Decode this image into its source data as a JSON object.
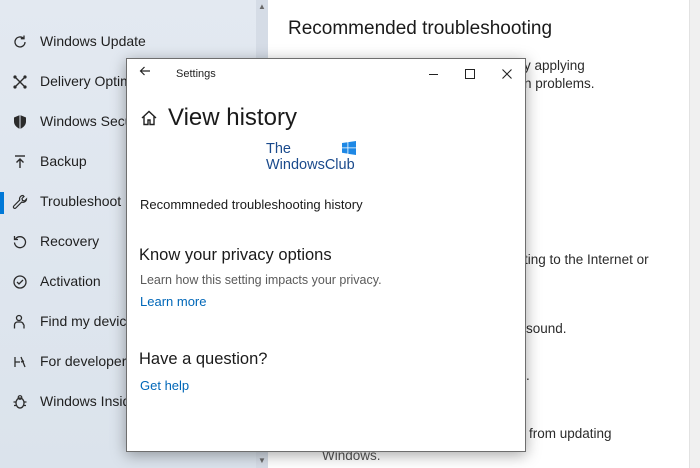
{
  "sidebar": {
    "items": [
      {
        "label": "Windows Update",
        "icon": "sync-icon"
      },
      {
        "label": "Delivery Optim",
        "icon": "delivery-icon"
      },
      {
        "label": "Windows Secu",
        "icon": "shield-icon"
      },
      {
        "label": "Backup",
        "icon": "backup-icon"
      },
      {
        "label": "Troubleshoot",
        "icon": "wrench-icon"
      },
      {
        "label": "Recovery",
        "icon": "recovery-icon"
      },
      {
        "label": "Activation",
        "icon": "activation-icon"
      },
      {
        "label": "Find my device",
        "icon": "person-location-icon"
      },
      {
        "label": "For developers",
        "icon": "developer-icon"
      },
      {
        "label": "Windows Insid",
        "icon": "insider-icon"
      }
    ],
    "selected_index": 4
  },
  "main": {
    "title": "Recommended troubleshooting",
    "fragments": [
      "y applying",
      "n problems.",
      "ting to the Internet or",
      "sound.",
      ".",
      "from updating",
      "Windows."
    ]
  },
  "dialog": {
    "window_title": "Settings",
    "page_title": "View history",
    "logo_line1": "The",
    "logo_line2": "WindowsClub",
    "history_label": "Recommneded troubleshooting history",
    "privacy_heading": "Know your privacy options",
    "privacy_desc": "Learn how this setting impacts your privacy.",
    "learn_more": "Learn more",
    "question_heading": "Have a question?",
    "get_help": "Get help"
  },
  "colors": {
    "accent": "#0078d7",
    "link": "#0067b8",
    "sidebar_bg": "#dfe6ef"
  }
}
